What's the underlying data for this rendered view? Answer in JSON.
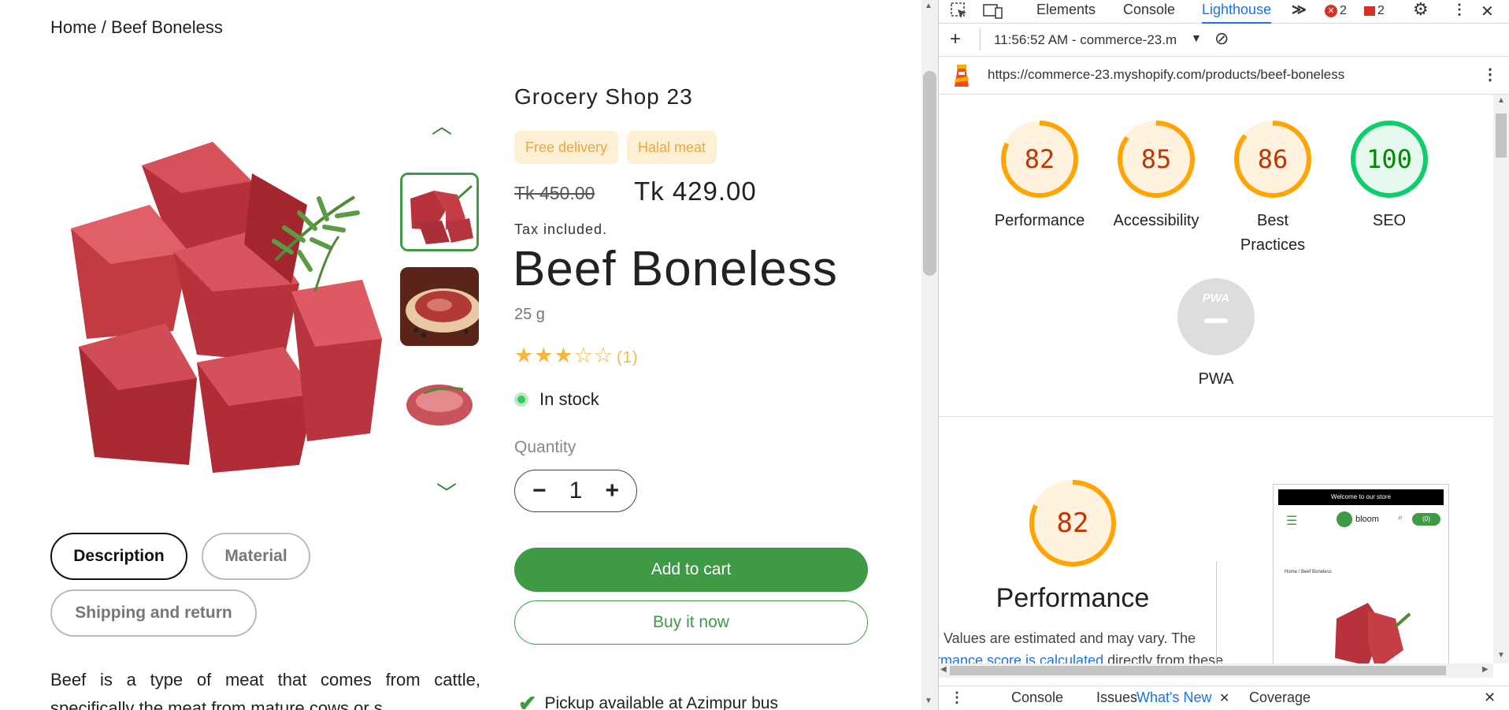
{
  "shop": {
    "breadcrumb": "Home / Beef Boneless",
    "vendor": "Grocery Shop 23",
    "badges": [
      "Free delivery",
      "Halal meat"
    ],
    "price_old": "Tk 450.00",
    "price_new": "Tk 429.00",
    "tax_note": "Tax included.",
    "title": "Beef Boneless",
    "weight": "25 g",
    "rating_stars": "★★★☆☆",
    "rating_count": "(1)",
    "stock": "In stock",
    "quantity_label": "Quantity",
    "quantity_value": "1",
    "qty_minus": "−",
    "qty_plus": "+",
    "add_to_cart": "Add to cart",
    "buy_now": "Buy it now",
    "pickup": "Pickup available at Azimpur bus",
    "tabs": [
      "Description",
      "Material",
      "Shipping and return"
    ],
    "description": "Beef is a type of meat that comes from cattle, specifically the meat from mature cows or s",
    "colors": {
      "accent": "#3e9a45",
      "badge_bg": "#fdf0d5",
      "badge_text": "#f2a53a",
      "stars": "#f4b73b"
    }
  },
  "devtools": {
    "tabs": [
      "Elements",
      "Console",
      "Lighthouse"
    ],
    "active_tab": "Lighthouse",
    "more_tabs_icon": "chevron-double-right-icon",
    "error_count": "2",
    "issue_count": "2",
    "report_selector": "11:56:52 AM - commerce-23.m",
    "url": "https://commerce-23.myshopify.com/products/beef-boneless",
    "scores": [
      {
        "label": "Performance",
        "value": "82",
        "color": "#ffa400",
        "bg": "#fff3e0",
        "text": "#c33300"
      },
      {
        "label": "Accessibility",
        "value": "85",
        "color": "#ffa400",
        "bg": "#fff3e0",
        "text": "#c33300"
      },
      {
        "label": "Best\nPractices",
        "value": "86",
        "color": "#ffa400",
        "bg": "#fff3e0",
        "text": "#c33300"
      },
      {
        "label": "SEO",
        "value": "100",
        "color": "#0cce6b",
        "bg": "#e6f9ee",
        "text": "#008800"
      }
    ],
    "pwa_label": "PWA",
    "pwa_badge": "PWA",
    "perf_score": "82",
    "perf_title": "Performance",
    "perf_note_1": "Values are estimated and may vary. The",
    "perf_note_link": "rmance score is calculated",
    "perf_note_2": " directly from these",
    "preview": {
      "banner": "Welcome to our store",
      "brand": "bloom",
      "cart": "(0)",
      "crumb": "Home / Beef Boneless"
    },
    "drawer_tabs": [
      "Console",
      "Issues",
      "What's New",
      "Coverage"
    ],
    "drawer_active": "What's New"
  }
}
